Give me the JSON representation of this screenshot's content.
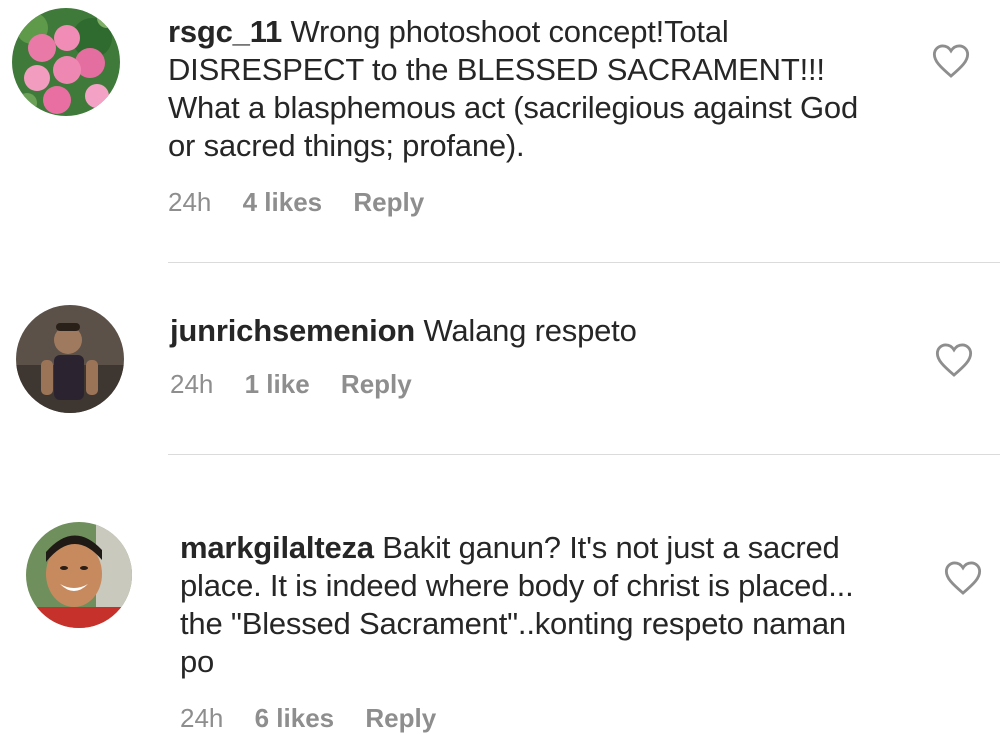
{
  "comments": [
    {
      "username": "rsgc_11",
      "text": "Wrong photoshoot concept!Total DISRESPECT to the BLESSED SACRAMENT!!! What a blasphemous act (sacrilegious against God or sacred things; profane).",
      "time": "24h",
      "likes": "4 likes",
      "reply": "Reply",
      "avatar_icon": "hydrangea-flowers-avatar"
    },
    {
      "username": "junrichsemenion",
      "text": "Walang respeto",
      "time": "24h",
      "likes": "1 like",
      "reply": "Reply",
      "avatar_icon": "person-photo-avatar"
    },
    {
      "username": "markgilalteza",
      "text": "Bakit ganun? It's not just a sacred place. It is indeed where body of christ is placed... the \"Blessed Sacrament\"..konting respeto naman po",
      "time": "24h",
      "likes": "6 likes",
      "reply": "Reply",
      "avatar_icon": "smiling-man-avatar"
    }
  ],
  "colors": {
    "text": "#262626",
    "meta": "#8e8e8e",
    "divider": "#dbdbdb",
    "heart": "#8e8e8e"
  }
}
